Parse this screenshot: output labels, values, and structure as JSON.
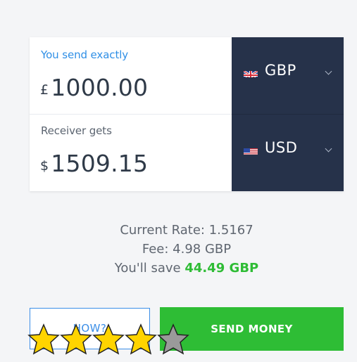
{
  "converter": {
    "send": {
      "label": "You send exactly",
      "currency_symbol": "£",
      "amount": "1000.00",
      "currency_code": "GBP",
      "flag_icon": "uk-flag-icon"
    },
    "receive": {
      "label": "Receiver gets",
      "currency_symbol": "$",
      "amount": "1509.15",
      "currency_code": "USD",
      "flag_icon": "us-flag-icon"
    }
  },
  "summary": {
    "rate_text": "Current Rate: 1.5167",
    "fee_text": "Fee: 4.98 GBP",
    "save_prefix": "You'll save",
    "save_value": "44.49 GBP"
  },
  "actions": {
    "how_label": "HOW?",
    "send_label": "SEND MONEY"
  },
  "rating": {
    "stars_filled": 4,
    "stars_total": 5
  },
  "colors": {
    "accent_blue": "#2f8fe6",
    "navy": "#26324a",
    "green": "#2ebd35",
    "star_gold": "#ffd400",
    "star_gray": "#9a9a9a"
  }
}
